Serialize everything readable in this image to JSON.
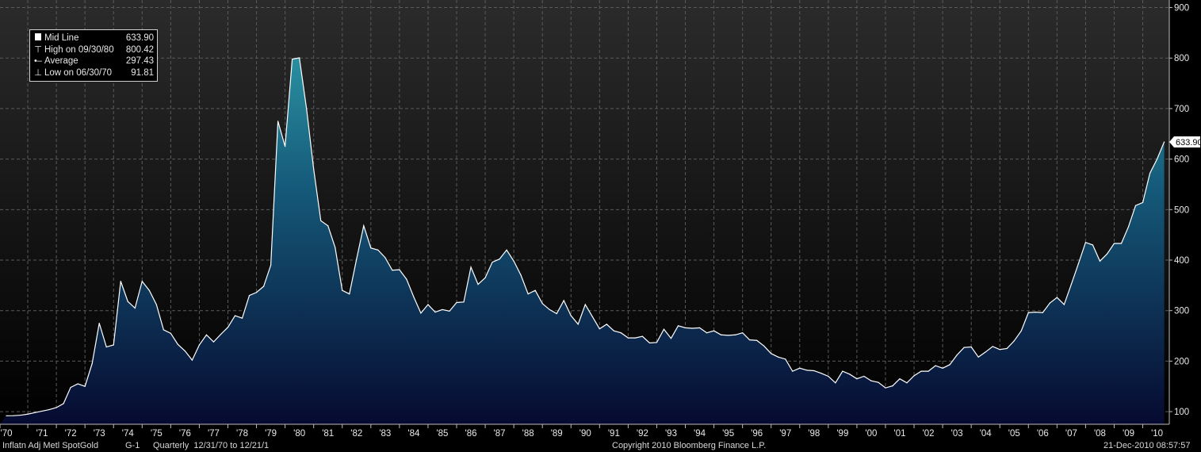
{
  "legend": {
    "rows": [
      {
        "symbol": "swatch-icon",
        "label": "Mid Line",
        "value": "633.90"
      },
      {
        "symbol": "high-marker-icon",
        "label": "High on 09/30/80",
        "value": "800.42"
      },
      {
        "symbol": "average-marker-icon",
        "label": "Average",
        "value": "297.43"
      },
      {
        "symbol": "low-marker-icon",
        "label": "Low on 06/30/70",
        "value": "91.81"
      }
    ]
  },
  "footer": {
    "security": "Inflatn Adj Metl SpotGold",
    "code": "G-1",
    "range": "Quarterly  12/31/70 to 12/21/1",
    "copyright": "Copyright 2010 Bloomberg Finance L.P.",
    "timestamp": "21-Dec-2010 08:57:57"
  },
  "colors": {
    "background": "#000000",
    "area_top": "#2a8fa0",
    "area_bottom": "#060a30",
    "line": "#ffffff",
    "grid": "#5a5a5a",
    "axis_text": "#e8e8e8"
  },
  "chart_data": {
    "type": "area",
    "start_year": 1970,
    "start_quarter": 2,
    "ylim": [
      75,
      915
    ],
    "yticks": [
      100,
      200,
      300,
      400,
      500,
      600,
      700,
      800,
      900
    ],
    "xticks": [
      "'70",
      "'71",
      "'72",
      "'73",
      "'74",
      "'75",
      "'76",
      "'77",
      "'78",
      "'79",
      "'80",
      "'81",
      "'82",
      "'83",
      "'84",
      "'85",
      "'86",
      "'87",
      "'88",
      "'89",
      "'90",
      "'91",
      "'92",
      "'93",
      "'94",
      "'95",
      "'96",
      "'97",
      "'98",
      "'99",
      "'00",
      "'01",
      "'02",
      "'03",
      "'04",
      "'05",
      "'06",
      "'07",
      "'08",
      "'09",
      "'10"
    ],
    "last_value_label": "633.90",
    "grid": true,
    "series": [
      {
        "values": [
          91.81,
          92,
          93,
          95,
          98,
          101,
          104,
          108,
          116,
          148,
          155,
          150,
          195,
          275,
          228,
          232,
          358,
          318,
          305,
          358,
          340,
          312,
          262,
          255,
          233,
          220,
          202,
          232,
          252,
          238,
          253,
          267,
          290,
          285,
          330,
          336,
          348,
          390,
          675,
          625,
          798,
          800.42,
          700,
          580,
          478,
          468,
          425,
          340,
          333,
          402,
          468,
          424,
          420,
          405,
          380,
          381,
          362,
          327,
          295,
          312,
          297,
          302,
          299,
          316,
          317,
          386,
          352,
          365,
          396,
          402,
          420,
          398,
          370,
          333,
          340,
          314,
          302,
          294,
          320,
          290,
          273,
          312,
          288,
          264,
          273,
          260,
          256,
          246,
          246,
          249,
          236,
          237,
          263,
          245,
          270,
          266,
          265,
          266,
          256,
          260,
          252,
          251,
          252,
          256,
          242,
          241,
          230,
          215,
          208,
          204,
          180,
          186,
          182,
          181,
          176,
          170,
          157,
          180,
          174,
          165,
          170,
          161,
          158,
          147,
          151,
          165,
          157,
          171,
          180,
          180,
          191,
          186,
          193,
          212,
          227,
          228,
          208,
          218,
          229,
          223,
          225,
          240,
          260,
          296,
          297,
          296,
          315,
          326,
          312,
          352,
          393,
          435,
          430,
          398,
          412,
          433,
          433,
          466,
          508,
          514,
          572,
          600,
          633.9
        ]
      }
    ]
  }
}
